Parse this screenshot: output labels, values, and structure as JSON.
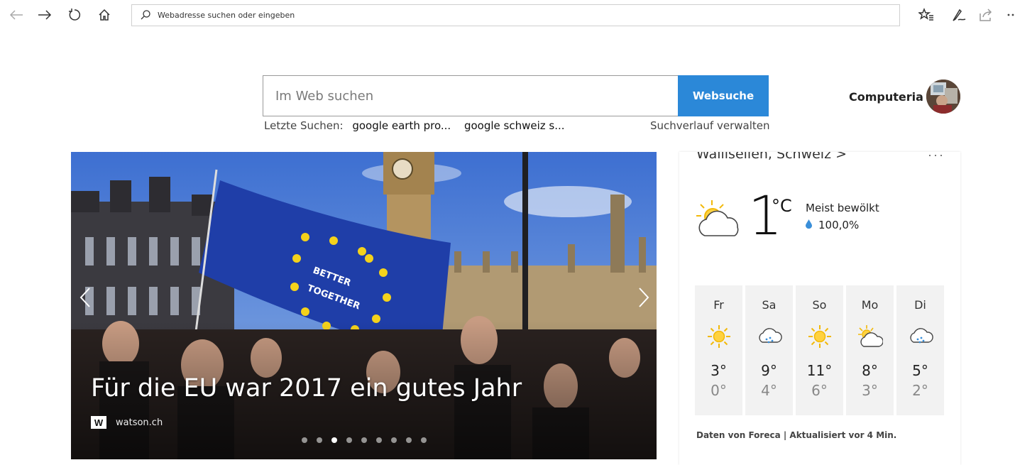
{
  "browser": {
    "address_placeholder": "Webadresse suchen oder eingeben",
    "icons": [
      "back-icon",
      "forward-icon",
      "refresh-icon",
      "home-icon",
      "favorites-icon",
      "notes-icon",
      "share-icon",
      "more-icon"
    ]
  },
  "search": {
    "placeholder": "Im Web suchen",
    "button_label": "Websuche",
    "recent_label": "Letzte Suchen:",
    "recent_items": [
      "google earth pro...",
      "google schweiz s..."
    ],
    "manage_history": "Suchverlauf verwalten",
    "accent_color": "#2b88d8"
  },
  "user": {
    "name": "Computeria"
  },
  "hero": {
    "headline": "Für die EU war 2017 ein gutes Jahr",
    "source_logo": "W",
    "source_name": "watson.ch",
    "slide_count": 9,
    "active_slide": 3
  },
  "weather": {
    "location": "Wallisellen, Schweiz >",
    "more": "···",
    "temperature": "1",
    "unit": "°C",
    "condition": "Meist bewölkt",
    "precipitation": "100,0%",
    "forecast": [
      {
        "day": "Fr",
        "icon": "sun-icon",
        "high": "3°",
        "low": "0°"
      },
      {
        "day": "Sa",
        "icon": "rain-cloud-icon",
        "high": "9°",
        "low": "4°"
      },
      {
        "day": "So",
        "icon": "sun-icon",
        "high": "11°",
        "low": "6°"
      },
      {
        "day": "Mo",
        "icon": "partly-cloudy-icon",
        "high": "8°",
        "low": "3°"
      },
      {
        "day": "Di",
        "icon": "rain-cloud-icon",
        "high": "5°",
        "low": "2°"
      }
    ],
    "footer": "Daten von Foreca | Aktualisiert vor 4 Min."
  }
}
